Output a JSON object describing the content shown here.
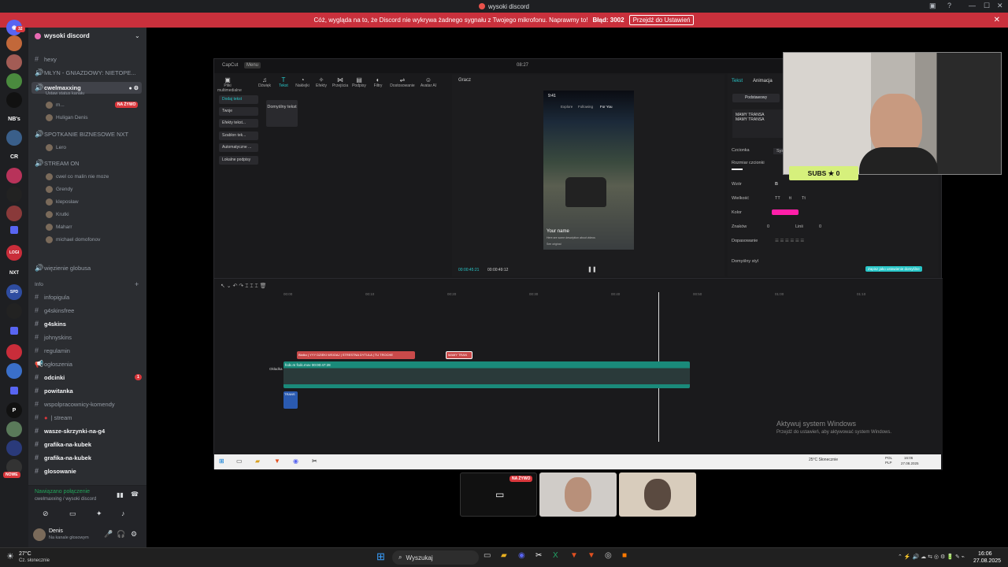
{
  "titlebar": {
    "title": "wysoki discord"
  },
  "notice": {
    "text": "Cóż, wygląda na to, że Discord nie wykrywa żadnego sygnału z Twojego mikrofonu. Naprawmy to!",
    "error": "Błąd: 3002",
    "button": "Przejdź do Ustawień",
    "close": "✕"
  },
  "rail": {
    "badge": "32",
    "items": [
      "NB's",
      "CR",
      "NXT",
      "SPD",
      "LOGI",
      "NOWE"
    ]
  },
  "server": {
    "name": "wysoki discord"
  },
  "channels": {
    "hexy": "hexy",
    "mlyn": "MŁYN - GNIAZDOWY: NIETOPE...",
    "cwel": "cwelmaxxing",
    "cwel_status": "Ustaw status kanału",
    "cwel_members": [
      "m...",
      "Huligan Denis"
    ],
    "live": "NA ŻYWO",
    "spotkanie": "SPOTKANIE BIZNESOWE NXT",
    "spotkanie_members": [
      "Lero"
    ],
    "stream": "STREAM ON",
    "stream_members": [
      "cwel co malin nie moze",
      "Grendy",
      "kleposław",
      "Krutki",
      "Maharr",
      "michael domofonov"
    ],
    "wiezienie": "więzienie globusa",
    "category": "Info",
    "list": [
      "infopigula",
      "g4skinsfree",
      "g4skins",
      "johnyskins",
      "regulamin",
      "ogłoszenia",
      "odcinki",
      "powitanka",
      "wspolpracownicy-komendy",
      "| stream",
      "wasze-skrzynki-na-g4",
      "grafika-na-kubek",
      "grafika-na-kubek",
      "glosowanie"
    ],
    "odcinki_badge": "1"
  },
  "voice": {
    "status": "Nawiązano połączenie",
    "channel": "cwelmaxxing / wysoki discord"
  },
  "user": {
    "name": "Denis",
    "status": "Na kanale głosowym"
  },
  "capcut": {
    "app": "CapCut",
    "menu": "Menu",
    "time": "08:27",
    "tools": [
      "Pliki multimedialne",
      "Dźwięk",
      "Tekst",
      "Naklejki",
      "Efekty",
      "Przejścia",
      "Podpisy",
      "Filtry",
      "Dostosowanie",
      "Avatar AI"
    ],
    "side": [
      "Dodaj tekst",
      "Twoje",
      "Efekty tekst...",
      "Szablon tek...",
      "Automatyczne ...",
      "Lokalne podpisy"
    ],
    "default": "Domyślny tekst",
    "player": "Gracz",
    "phone": {
      "time": "9:41",
      "tabs": [
        "Explore",
        "Following",
        "For You"
      ],
      "name": "Your name",
      "caption": "Here are some description about videos",
      "translate": "See original"
    },
    "timecode": "00:00:45:21",
    "duration": "00:00:49:12",
    "props": {
      "tabs": [
        "Tekst",
        "Animacja"
      ],
      "preset": "Podstawowy",
      "text": "MAMY TRANSA\nMAMY TRANSA",
      "font_label": "Czcionka",
      "font_val": "Syst",
      "size_label": "Rozmiar czcionki",
      "style_label": "Wzór",
      "case_label": "Wielkość",
      "case_opts": [
        "TT",
        "tt",
        "Tt"
      ],
      "color_label": "Kolor",
      "color": "#ff1fa9",
      "chars_label": "Znaków",
      "chars_val": "0",
      "lines_label": "Linii",
      "lines_val": "0",
      "align_label": "Dopasowanie",
      "default_style": "Domyślny styl",
      "save_btn": "Zapisz jako ustawienie domyślne"
    },
    "ruler": [
      "00:00",
      "00:10",
      "00:20",
      "00:30",
      "00:40",
      "00:50",
      "01:00",
      "01:10"
    ],
    "clips": {
      "texts": [
        "Bialko",
        "YYY DZIEKI WSIOAJ",
        "STRESTNA DYTULA",
        "TU TROCHE"
      ],
      "selected": "MAMY TRAN",
      "video1": "fcdc.m",
      "video2": "fcdc.mov",
      "video_time": "00:00:47:28",
      "audio": "TRANS",
      "cover": "Okładka"
    },
    "watermark_title": "Aktywuj system Windows",
    "watermark_sub": "Przejdź do ustawień, aby aktywować system Windows.",
    "inner_taskbar": {
      "weather": "25°C Słonecznie",
      "lang": "POL\nPLP",
      "time": "16:06",
      "date": "27.08.2025"
    }
  },
  "overlay": {
    "subs": "SUBS ★ 0"
  },
  "tiles": {
    "live": "NA ŻYWO"
  },
  "taskbar": {
    "weather_temp": "27°C",
    "weather_desc": "Cz. słonecznie",
    "search": "Wyszukaj",
    "time": "16:06",
    "date": "27.08.2025"
  }
}
